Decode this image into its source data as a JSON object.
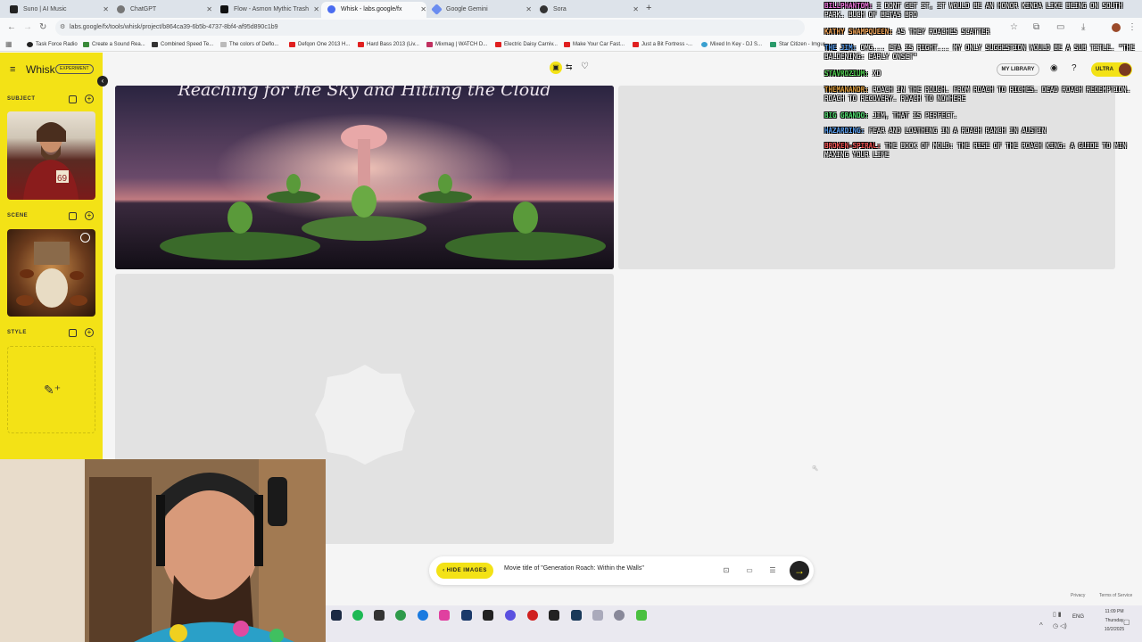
{
  "browser": {
    "tabs": [
      {
        "label": "Suno | AI Music",
        "active": false
      },
      {
        "label": "ChatGPT",
        "active": false
      },
      {
        "label": "Flow - Asmon Mythic Trash",
        "active": false
      },
      {
        "label": "Whisk - labs.google/fx",
        "active": true
      },
      {
        "label": "Google Gemini",
        "active": false
      },
      {
        "label": "Sora",
        "active": false
      }
    ],
    "url": "labs.google/fx/tools/whisk/project/b864ca39-6b5b-4737-8bf4-af95d890c1b9",
    "bookmarks": [
      "Task Force Radio",
      "Create a Sound Rea...",
      "Combined Speed Te...",
      "The colors of Deflo...",
      "Defqon One 2013 H...",
      "Hard Bass 2013 (Liv...",
      "Mixmag | WATCH D...",
      "Electric Daisy Carniv...",
      "Make Your Car Fast...",
      "Just a Bit Fortress -...",
      "Mixed In Key - DJ S...",
      "Star Citizen - Imgur"
    ]
  },
  "app": {
    "name": "Whisk",
    "badge": "EXPERIMENT",
    "my_library": "MY LIBRARY",
    "ultra": "ULTRA",
    "sidebar": {
      "subject_label": "SUBJECT",
      "scene_label": "SCENE",
      "style_label": "STYLE"
    },
    "main_image_caption": "Reaching for the Sky and Hitting the Cloud",
    "prompt": {
      "hide_images": "HIDE IMAGES",
      "text": "Movie title of \"Generation Roach: Within the Walls\""
    },
    "footer": {
      "privacy": "Privacy",
      "terms": "Terms of Service"
    }
  },
  "chat": [
    {
      "user": "BillPhantom:",
      "color": "#e86fd6",
      "text": "I dont get it, it would be an honor kinda like being on South Park. Buch of betas bro"
    },
    {
      "user": "Kathy SwampQueen:",
      "color": "#f2a65a",
      "text": "As they roaches scatter"
    },
    {
      "user": "The Jim:",
      "color": "#5aa0f2",
      "text": "Omg... Eta is right... My only suggestion would be a sub title. \"The Baldening: early onset\""
    },
    {
      "user": "Stavrozium:",
      "color": "#50d050",
      "text": "XD"
    },
    {
      "user": "TheManAndr:",
      "color": "#e0a040",
      "text": "Roach in the rough. From roach to riches. Dead roach redemption. Roach to recovery. Roach to nowhere"
    },
    {
      "user": "Big Grando:",
      "color": "#50e070",
      "text": "Jim, that is perfect."
    },
    {
      "user": "Hazarding:",
      "color": "#5aa0f2",
      "text": "Fear and loathing in a roach ranch in Austin"
    },
    {
      "user": "Broken-Spiral:",
      "color": "#f05050",
      "text": "The book of mold: the rise of the roach king: A guide to min maxing your life"
    }
  ],
  "taskbar": {
    "lang": "ENG",
    "time": "11:09 PM",
    "day": "Thursday",
    "date": "10/2/2025"
  }
}
